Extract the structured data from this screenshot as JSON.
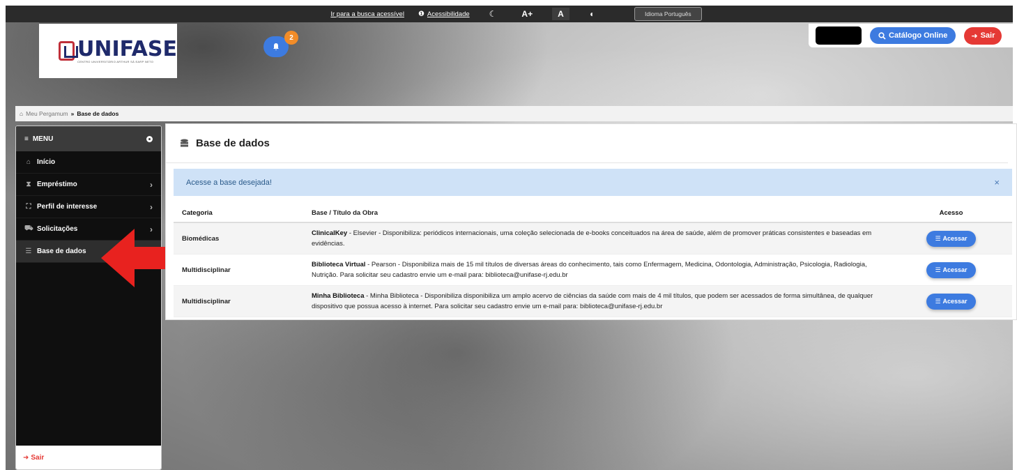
{
  "topbar": {
    "busca_link": "Ir para a busca acessível",
    "acessibilidade_link": "Acessibilidade",
    "contrast_btn": "☾",
    "font_inc_btn": "A+",
    "font_reset_btn": "A",
    "font_dec_btn": "◖",
    "idioma": "Idioma Português"
  },
  "header": {
    "logo_word": "UNIFASE",
    "logo_sub": "CENTRO UNIVERSITÁRIO ARTHUR SÁ EARP NETO",
    "notifications_count": "2",
    "catalogo_label": "Catálogo Online",
    "sair_label": "Sair"
  },
  "breadcrumb": {
    "home": "Meu Pergamum",
    "sep": "»",
    "current": "Base de dados"
  },
  "sidebar": {
    "menu_label": "MENU",
    "items": [
      {
        "label": "Início",
        "icon": "⌂",
        "chevron": ""
      },
      {
        "label": "Empréstimo",
        "icon": "⧗",
        "chevron": "›"
      },
      {
        "label": "Perfil de interesse",
        "icon": "⛶",
        "chevron": "›"
      },
      {
        "label": "Solicitações",
        "icon": "⛟",
        "chevron": "›"
      },
      {
        "label": "Base de dados",
        "icon": "☰",
        "chevron": ""
      }
    ],
    "footer_sair": "Sair"
  },
  "main": {
    "title": "Base de dados",
    "alert": "Acesse a base desejada!",
    "alert_close": "×",
    "columns": [
      "Categoria",
      "Base / Título da Obra",
      "Acesso"
    ],
    "rows": [
      {
        "categoria": "Biomédicas",
        "titulo": "ClinicalKey",
        "descricao": " - Elsevier - Disponibiliza: periódicos internacionais, uma coleção selecionada de e-books conceituados na área de saúde, além de promover práticas consistentes e baseadas em evidências.",
        "acesso": "Acessar"
      },
      {
        "categoria": "Multidisciplinar",
        "titulo": "Biblioteca Virtual",
        "descricao": " - Pearson - Disponibiliza mais de 15 mil títulos de diversas áreas do conhecimento, tais como Enfermagem, Medicina, Odontologia, Administração, Psicologia, Radiologia, Nutrição. Para solicitar seu cadastro envie um e-mail para: biblioteca@unifase-rj.edu.br",
        "acesso": "Acessar"
      },
      {
        "categoria": "Multidisciplinar",
        "titulo": "Minha Biblioteca",
        "descricao": " - Minha Biblioteca - Disponibiliza disponibiliza um amplo acervo de ciências da saúde com mais de 4 mil títulos, que podem ser acessados de forma simultânea, de qualquer dispositivo que possua acesso à internet. Para solicitar seu cadastro envie um e-mail para: biblioteca@unifase-rj.edu.br",
        "acesso": "Acessar"
      }
    ]
  },
  "colors": {
    "primary": "#3d7be0",
    "danger": "#e53935",
    "alert_bg": "#cfe2f7",
    "badge": "#f28c28",
    "arrow": "#e8221f"
  }
}
